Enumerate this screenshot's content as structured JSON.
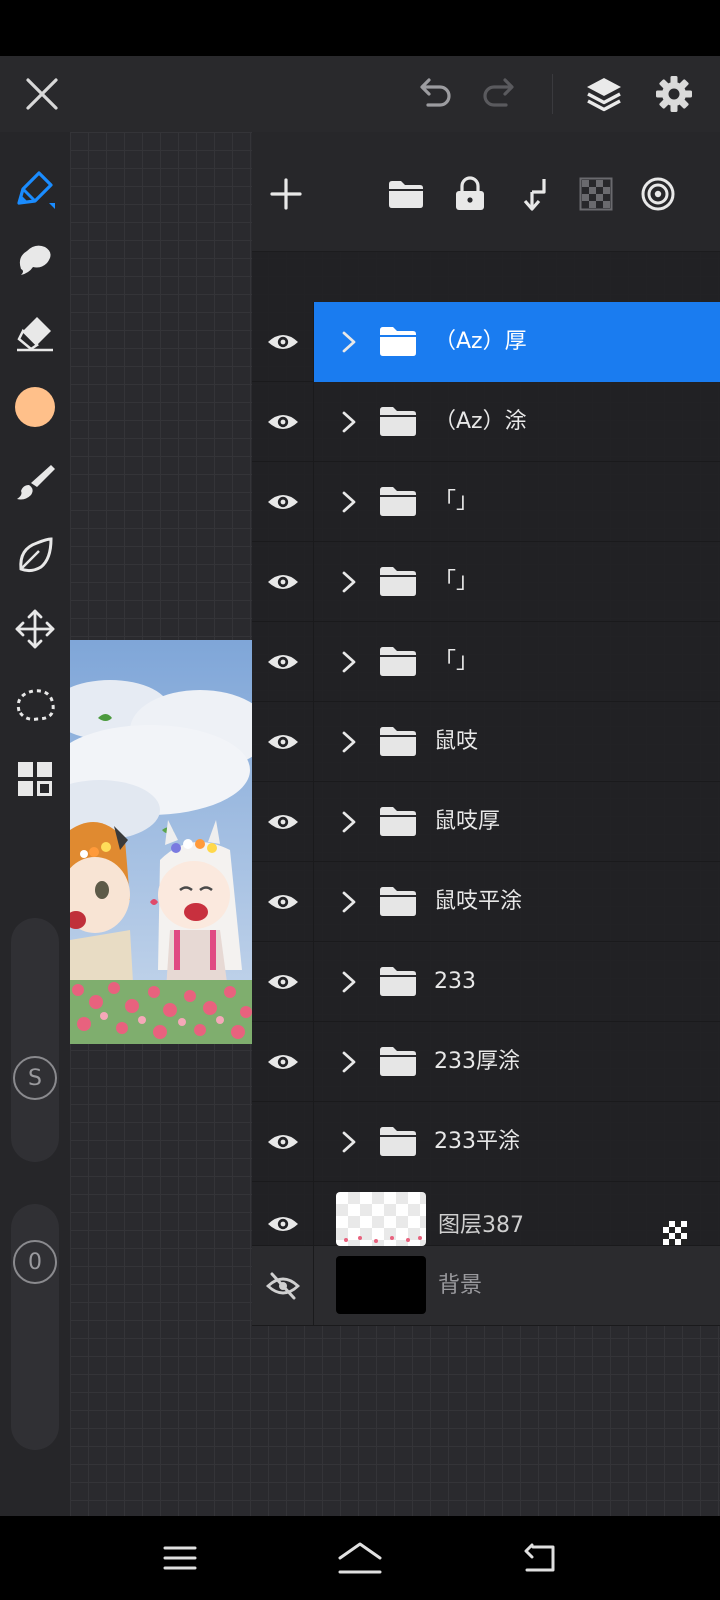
{
  "top_bar": {
    "close_icon": "close-icon",
    "undo_icon": "undo-icon",
    "redo_icon": "redo-icon",
    "layers_icon": "layers-icon",
    "settings_icon": "gear-icon"
  },
  "left_toolbar": {
    "tools": [
      "pen",
      "smudge",
      "eraser",
      "color",
      "brush",
      "lasso-leaf",
      "transform",
      "selection",
      "gallery"
    ],
    "active_tool": "pen",
    "accent_color": "#1a7cf0",
    "current_color": "#ffc08a",
    "size_slider_label": "S",
    "opacity_slider_label": "0"
  },
  "layer_panel": {
    "toolbar_icons": [
      "add-icon",
      "folder-icon",
      "lock-icon",
      "merge-down-icon",
      "alpha-lock-icon",
      "reference-icon"
    ],
    "layers": [
      {
        "name": "（Az）厚",
        "type": "folder",
        "visible": true,
        "selected": true
      },
      {
        "name": "（Az）涂",
        "type": "folder",
        "visible": true,
        "selected": false
      },
      {
        "name": "「」",
        "type": "folder",
        "visible": true,
        "selected": false
      },
      {
        "name": "「」",
        "type": "folder",
        "visible": true,
        "selected": false
      },
      {
        "name": "「」",
        "type": "folder",
        "visible": true,
        "selected": false
      },
      {
        "name": "鼠吱",
        "type": "folder",
        "visible": true,
        "selected": false
      },
      {
        "name": "鼠吱厚",
        "type": "folder",
        "visible": true,
        "selected": false
      },
      {
        "name": "鼠吱平涂",
        "type": "folder",
        "visible": true,
        "selected": false
      },
      {
        "name": "233",
        "type": "folder",
        "visible": true,
        "selected": false
      },
      {
        "name": "233厚涂",
        "type": "folder",
        "visible": true,
        "selected": false
      },
      {
        "name": "233平涂",
        "type": "folder",
        "visible": true,
        "selected": false
      },
      {
        "name": "图层387",
        "type": "layer",
        "visible": true,
        "selected": false
      },
      {
        "name": "背景",
        "type": "background",
        "visible": false,
        "selected": false
      }
    ]
  },
  "nav_bar": {
    "menu_icon": "menu-icon",
    "home_icon": "home-icon",
    "back_icon": "back-icon"
  }
}
